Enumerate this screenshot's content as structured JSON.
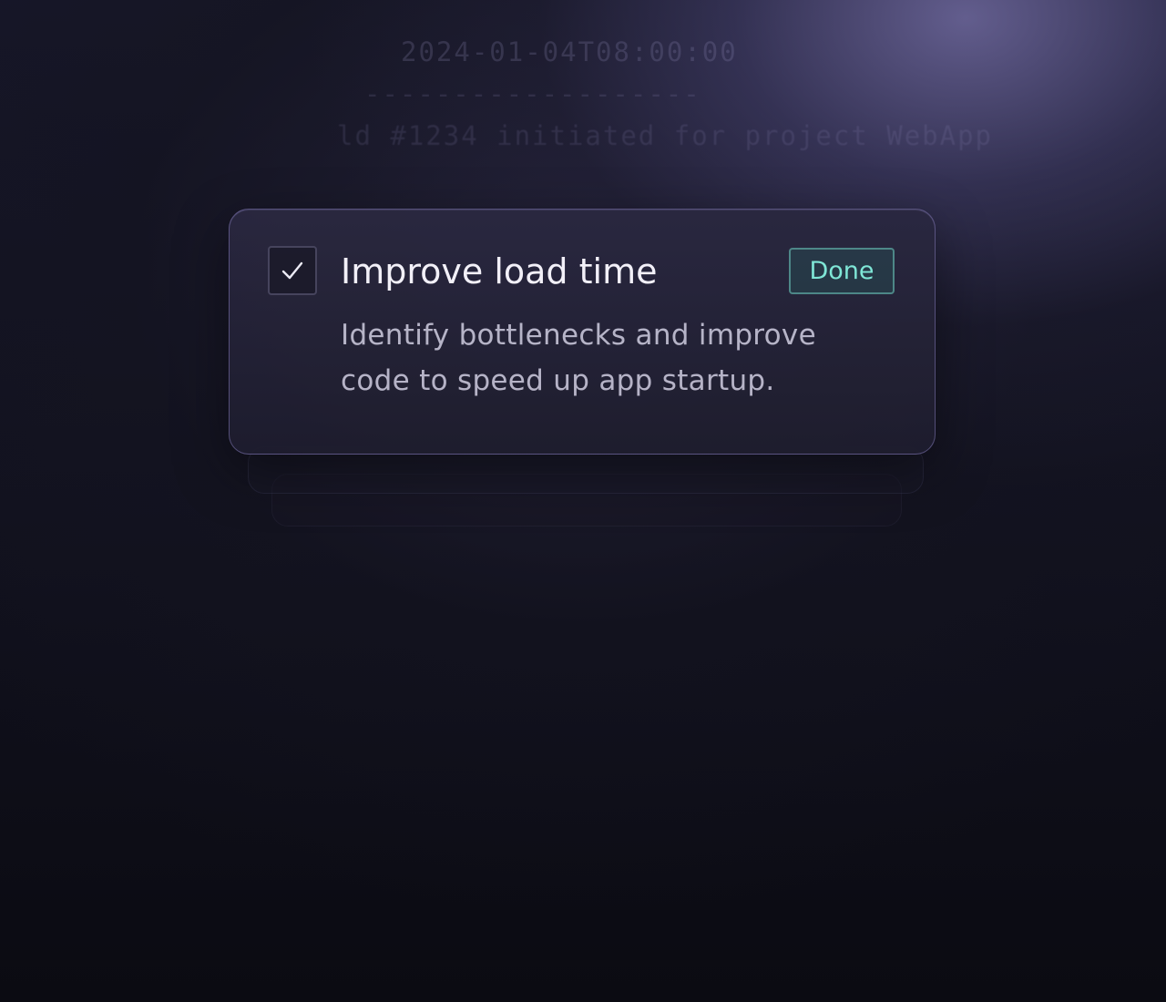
{
  "background_log": {
    "timestamp": "2024-01-04T08:00:00",
    "separator": "-------------------",
    "message": "ld #1234 initiated for project WebApp"
  },
  "task_card": {
    "checked": true,
    "title": "Improve load time",
    "description": "Identify bottlenecks and improve code to speed up app startup.",
    "status_button_label": "Done"
  },
  "colors": {
    "accent_teal": "#7fe6d6",
    "title_text": "#f2f0f8",
    "card_border": "#9a8cd2",
    "background": "#0b0b12"
  }
}
